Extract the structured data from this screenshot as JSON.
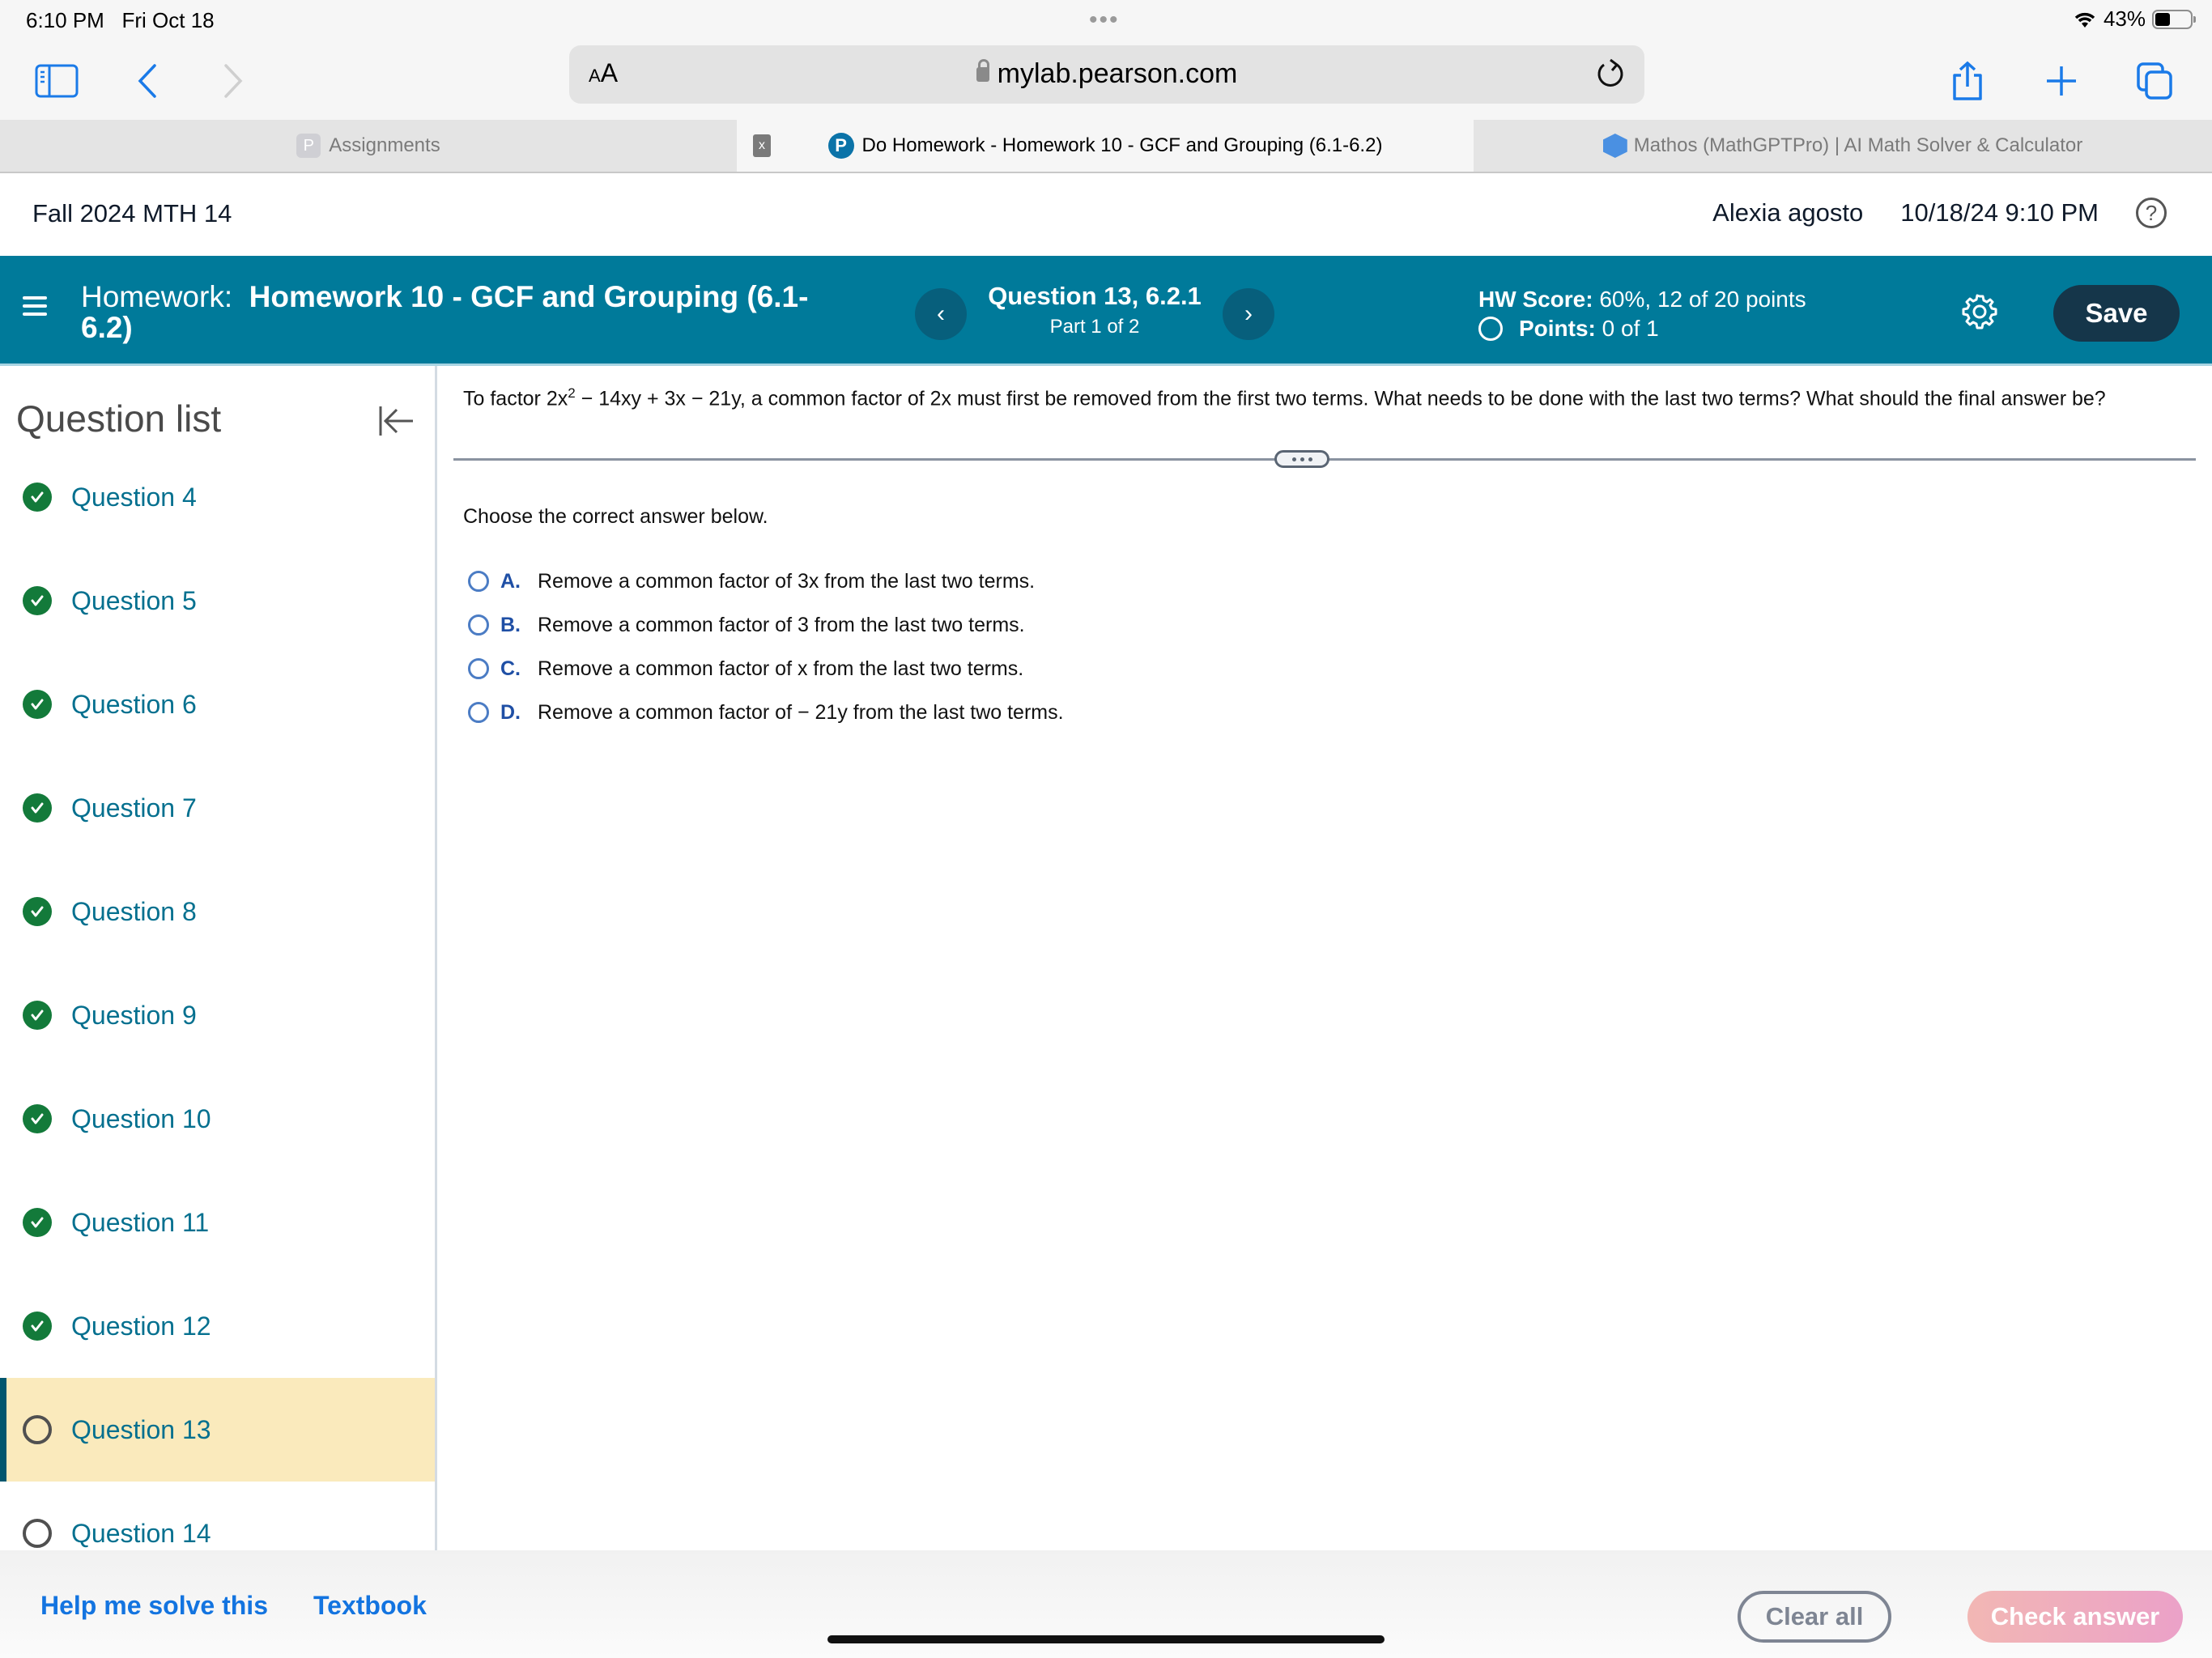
{
  "status_bar": {
    "time": "6:10 PM",
    "date": "Fri Oct 18",
    "battery_percent_label": "43%",
    "battery_level": 0.43
  },
  "browser": {
    "url": "mylab.pearson.com",
    "text_size_label_small": "A",
    "text_size_label_large": "A",
    "tabs": [
      {
        "label": "Assignments",
        "favicon": "P",
        "active": false
      },
      {
        "label": "Do Homework - Homework 10 - GCF and Grouping (6.1-6.2)",
        "favicon": "P",
        "active": true
      },
      {
        "label": "Mathos (MathGPTPro) | AI Math Solver & Calculator",
        "favicon": "mathos-cube",
        "active": false
      }
    ],
    "tab_close_glyph": "x"
  },
  "course_header": {
    "course_title": "Fall 2024 MTH 14",
    "user_name": "Alexia agosto",
    "datetime": "10/18/24 9:10 PM",
    "help_glyph": "?"
  },
  "banner": {
    "homework_label": "Homework:",
    "homework_name": "Homework 10 - GCF and Grouping (6.1-6.2)",
    "question_label": "Question 13, 6.2.1",
    "part_label": "Part 1 of 2",
    "prev_glyph": "‹",
    "next_glyph": "›",
    "hw_score_label": "HW Score:",
    "hw_score_value": "60%, 12 of 20 points",
    "points_label": "Points:",
    "points_value": "0 of 1",
    "save_label": "Save",
    "colors": {
      "banner": "#007a9a",
      "save_button": "#15364a"
    }
  },
  "sidebar": {
    "title": "Question list",
    "items": [
      {
        "label": "Question 4",
        "status": "complete"
      },
      {
        "label": "Question 5",
        "status": "complete"
      },
      {
        "label": "Question 6",
        "status": "complete"
      },
      {
        "label": "Question 7",
        "status": "complete"
      },
      {
        "label": "Question 8",
        "status": "complete"
      },
      {
        "label": "Question 9",
        "status": "complete"
      },
      {
        "label": "Question 10",
        "status": "complete"
      },
      {
        "label": "Question 11",
        "status": "complete"
      },
      {
        "label": "Question 12",
        "status": "complete"
      },
      {
        "label": "Question 13",
        "status": "incomplete",
        "active": true
      },
      {
        "label": "Question 14",
        "status": "incomplete"
      }
    ],
    "colors": {
      "complete": "#137a3a",
      "active_bg": "#faeabc",
      "link": "#05708f"
    }
  },
  "question": {
    "text_prefix": "To factor 2x",
    "text_superscript": "2",
    "text_suffix": " − 14xy + 3x − 21y, a common factor of 2x must first be removed from the first two terms. What needs to be done with the last two terms? What should the final answer be?",
    "instruction": "Choose the correct answer below.",
    "options": [
      {
        "letter": "A.",
        "text": "Remove a common factor of 3x from the last two terms."
      },
      {
        "letter": "B.",
        "text": "Remove a common factor of 3 from the last two terms."
      },
      {
        "letter": "C.",
        "text": "Remove a common factor of x from the last two terms."
      },
      {
        "letter": "D.",
        "text": "Remove a common factor of  − 21y from the last two terms."
      }
    ]
  },
  "footer": {
    "help_link": "Help me solve this",
    "textbook_link": "Textbook",
    "clear_all_label": "Clear all",
    "check_answer_label": "Check answer"
  }
}
